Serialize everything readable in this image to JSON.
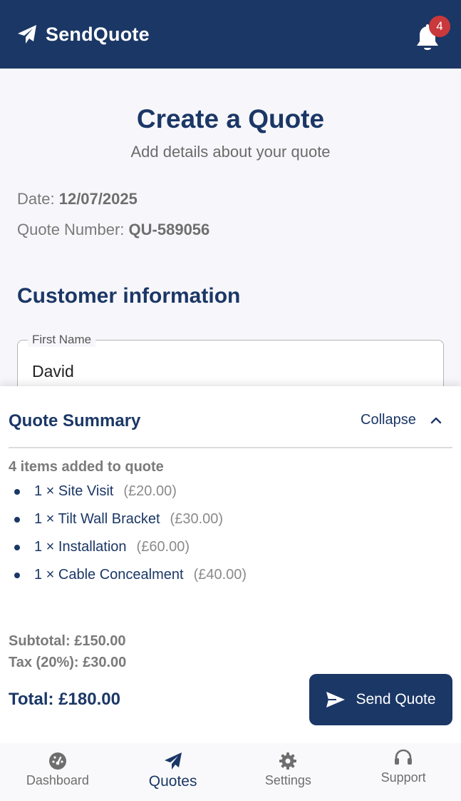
{
  "header": {
    "app_name": "SendQuote",
    "notification_count": "4"
  },
  "form": {
    "title": "Create a Quote",
    "subtitle": "Add details about your quote",
    "date_label": "Date:",
    "date_value": "12/07/2025",
    "quote_number_label": "Quote Number:",
    "quote_number_value": "QU-589056",
    "customer_section_title": "Customer information",
    "first_name_label": "First Name",
    "first_name_value": "David"
  },
  "summary": {
    "title": "Quote Summary",
    "collapse_label": "Collapse",
    "items_count_text": "4 items added to quote",
    "items": [
      {
        "name": "1 × Site Visit",
        "price": "(£20.00)"
      },
      {
        "name": "1 × Tilt Wall Bracket",
        "price": "(£30.00)"
      },
      {
        "name": "1 × Installation",
        "price": "(£60.00)"
      },
      {
        "name": "1 × Cable Concealment",
        "price": "(£40.00)"
      }
    ],
    "subtotal_text": "Subtotal: £150.00",
    "tax_text": "Tax (20%): £30.00",
    "total_text": "Total: £180.00",
    "send_button_label": "Send Quote"
  },
  "nav": {
    "items": [
      {
        "label": "Dashboard",
        "icon": "dashboard-gauge-icon",
        "active": false
      },
      {
        "label": "Quotes",
        "icon": "paper-plane-icon",
        "active": true
      },
      {
        "label": "Settings",
        "icon": "gear-icon",
        "active": false
      },
      {
        "label": "Support",
        "icon": "headset-icon",
        "active": false
      }
    ]
  },
  "colors": {
    "primary": "#1b3766",
    "badge": "#c9383a",
    "background": "#f7f7fb"
  }
}
